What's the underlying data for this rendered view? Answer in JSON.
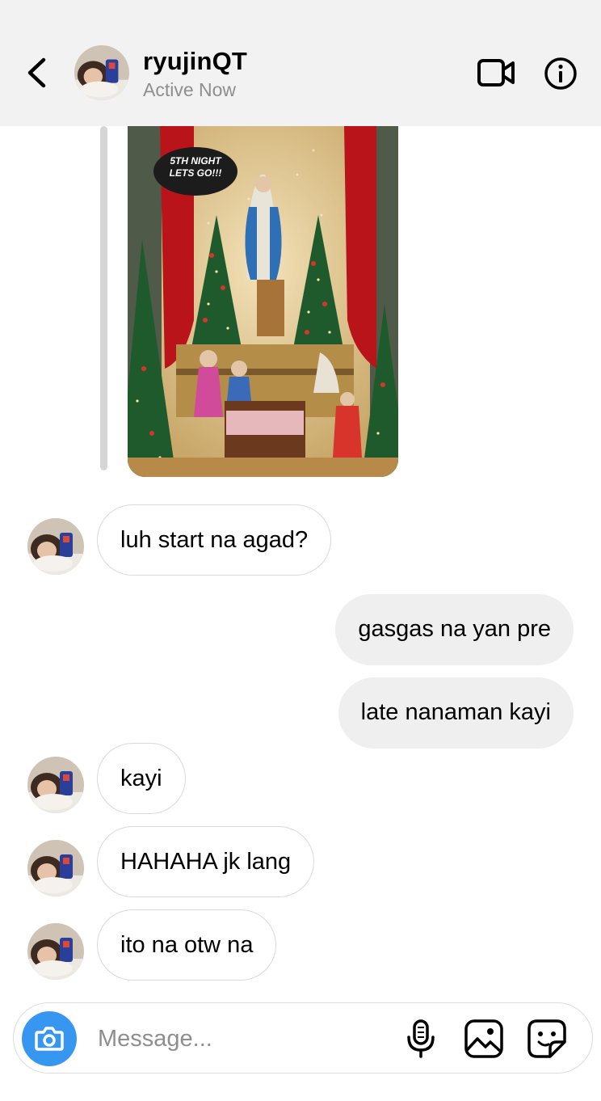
{
  "header": {
    "username": "ryujinQT",
    "status": "Active Now"
  },
  "shared_post": {
    "caption": "5TH NIGHT LETS GO!!!"
  },
  "messages": [
    {
      "side": "in",
      "text": "luh start na agad?"
    },
    {
      "side": "out",
      "text": "gasgas na yan pre"
    },
    {
      "side": "out",
      "text": "late nanaman kayi"
    },
    {
      "side": "in",
      "text": "kayi"
    },
    {
      "side": "in",
      "text": "HAHAHA jk lang"
    },
    {
      "side": "in",
      "text": "ito na otw na"
    }
  ],
  "composer": {
    "placeholder": "Message..."
  },
  "icons": {
    "back": "chevron-left-icon",
    "video": "video-camera-icon",
    "info": "info-icon",
    "camera": "camera-icon",
    "mic": "microphone-icon",
    "gallery": "image-icon",
    "sticker": "sticker-icon"
  },
  "colors": {
    "accent": "#3797f0",
    "header_bg": "#f2f2f2",
    "outgoing_bubble": "#efefef",
    "incoming_border": "#d9d9d9",
    "secondary_text": "#8e8e8e"
  }
}
